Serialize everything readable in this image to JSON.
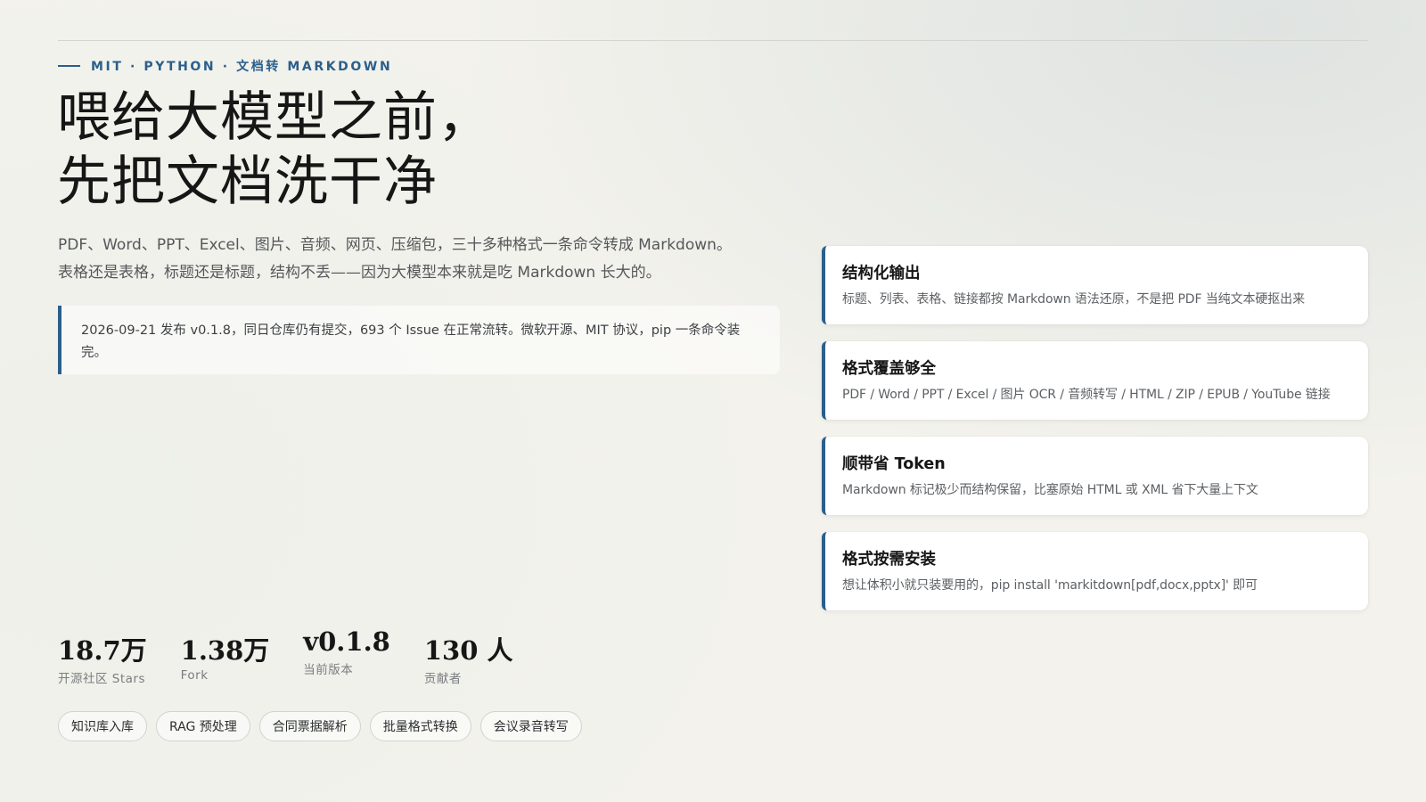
{
  "eyebrow": "MIT · PYTHON · 文档转 MARKDOWN",
  "headline": {
    "line1": "喂给大模型之前，",
    "line2": "先把文档洗干净"
  },
  "lede": {
    "line1": "PDF、Word、PPT、Excel、图片、音频、网页、压缩包，三十多种格式一条命令转成 Markdown。",
    "line2": "表格还是表格，标题还是标题，结构不丢——因为大模型本来就是吃 Markdown 长大的。"
  },
  "notice": "2026-09-21 发布 v0.1.8，同日仓库仍有提交，693 个 Issue 在正常流转。微软开源、MIT 协议，pip 一条命令装完。",
  "stats": [
    {
      "value": "18.7万",
      "label": "开源社区 Stars"
    },
    {
      "value": "1.38万",
      "label": "Fork"
    },
    {
      "value": "v0.1.8",
      "label": "当前版本"
    },
    {
      "value": "130 人",
      "label": "贡献者"
    }
  ],
  "tags": [
    "知识库入库",
    "RAG 预处理",
    "合同票据解析",
    "批量格式转换",
    "会议录音转写"
  ],
  "features": [
    {
      "title": "结构化输出",
      "desc": "标题、列表、表格、链接都按 Markdown 语法还原，不是把 PDF 当纯文本硬抠出来"
    },
    {
      "title": "格式覆盖够全",
      "desc": "PDF / Word / PPT / Excel / 图片 OCR / 音频转写 / HTML / ZIP / EPUB / YouTube 链接"
    },
    {
      "title": "顺带省 Token",
      "desc": "Markdown 标记极少而结构保留，比塞原始 HTML 或 XML 省下大量上下文"
    },
    {
      "title": "格式按需安装",
      "desc": "想让体积小就只装要用的，pip install 'markitdown[pdf,docx,pptx]' 即可"
    }
  ],
  "colors": {
    "accent": "#2a5f8c",
    "background": "#f3f2ec",
    "card": "#ffffff"
  }
}
